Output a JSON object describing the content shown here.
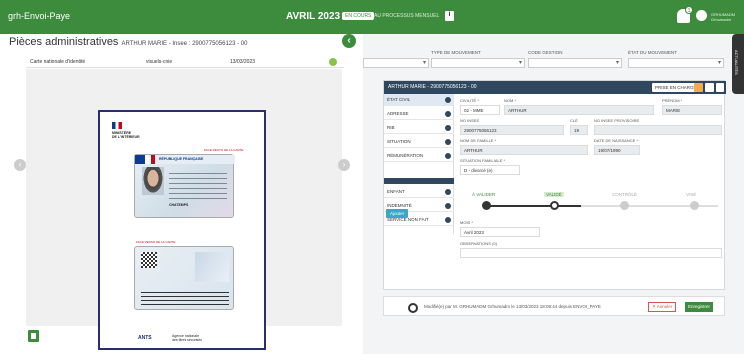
{
  "app": {
    "title": "grh-Envoi-Paye"
  },
  "period": {
    "label": "AVRIL 2023",
    "status": "EN COURS",
    "info": "AU PROCESSUS MENSUEL"
  },
  "user": {
    "line1": "GRHUMADM",
    "line2": "Grhumadm",
    "notif_count": "1"
  },
  "modal": {
    "title": "Pièces administratives",
    "subtitle": "ARTHUR MARIE - Insee : 2900775056123 - 00",
    "doc": {
      "type": "Carte nationale d'identité",
      "file": "visuels-cnie",
      "date": "13/03/2023"
    },
    "paper": {
      "ministry": [
        "MINISTÈRE",
        "DE L'INTÉRIEUR"
      ],
      "recto_label": "FACE RECTO DE LA CARTE",
      "verso_label": "FACE VERSO DE LA CARTE",
      "card_title": "RÉPUBLIQUE FRANÇAISE",
      "card_name": "CHATEMPS",
      "agency_logo": "ANTS",
      "agency": [
        "Agence nationale",
        "des titres sécurisés"
      ]
    }
  },
  "filters": {
    "labels": [
      "TYPE DE MOUVEMENT",
      "CODE GESTION",
      "ÉTAT DU MOUVEMENT"
    ]
  },
  "dossier": {
    "header": "ARTHUR MARIE - 2900775056123 - 00",
    "prise_label": "PRISE EN CHARGE",
    "nav": [
      "ÉTAT CIVIL",
      "ADRESSE",
      "RIB",
      "SITUATION",
      "RÉMUNÉRATION",
      "ENFANT",
      "INDEMNITÉ",
      "SERVICE NON FAIT"
    ],
    "ajouter": "Ajouter",
    "fields": {
      "civilite_label": "CIVILITÉ *",
      "civilite": "02 - MME",
      "nom_label": "NOM *",
      "nom": "ARTHUR",
      "prenom_label": "PRÉNOM *",
      "prenom": "MARIE",
      "insee_label": "NO INSEE",
      "insee": "2900775056123",
      "cle_label": "CLÉ",
      "cle": "19",
      "insee_prov_label": "NO INSEE PROVISOIRE",
      "famille_label": "NOM DE FAMILLE *",
      "famille": "ARTHUR",
      "naissance_label": "DATE DE NAISSANCE *",
      "naissance": "19/07/1990",
      "sitfam_label": "SITUATION FAMILIALE *",
      "sitfam": "D - divorcé (e)",
      "mois_label": "MOIS *",
      "mois": "Avril 2023",
      "obs_label": "OBSERVATIONS (0)"
    },
    "steps": [
      "À VALIDER",
      "VALIDÉ",
      "CONTRÔLÉ",
      "VISÉ"
    ],
    "footer": "Modifié(e) par M. GRHUMADM Grhumadm le 13/03/2023 18:08:44 depuis ENVOI_PAYE",
    "annuler": "✕ Annuler",
    "enregistrer": "Enregistrer"
  },
  "sidetab": "ACTUALITÉS"
}
